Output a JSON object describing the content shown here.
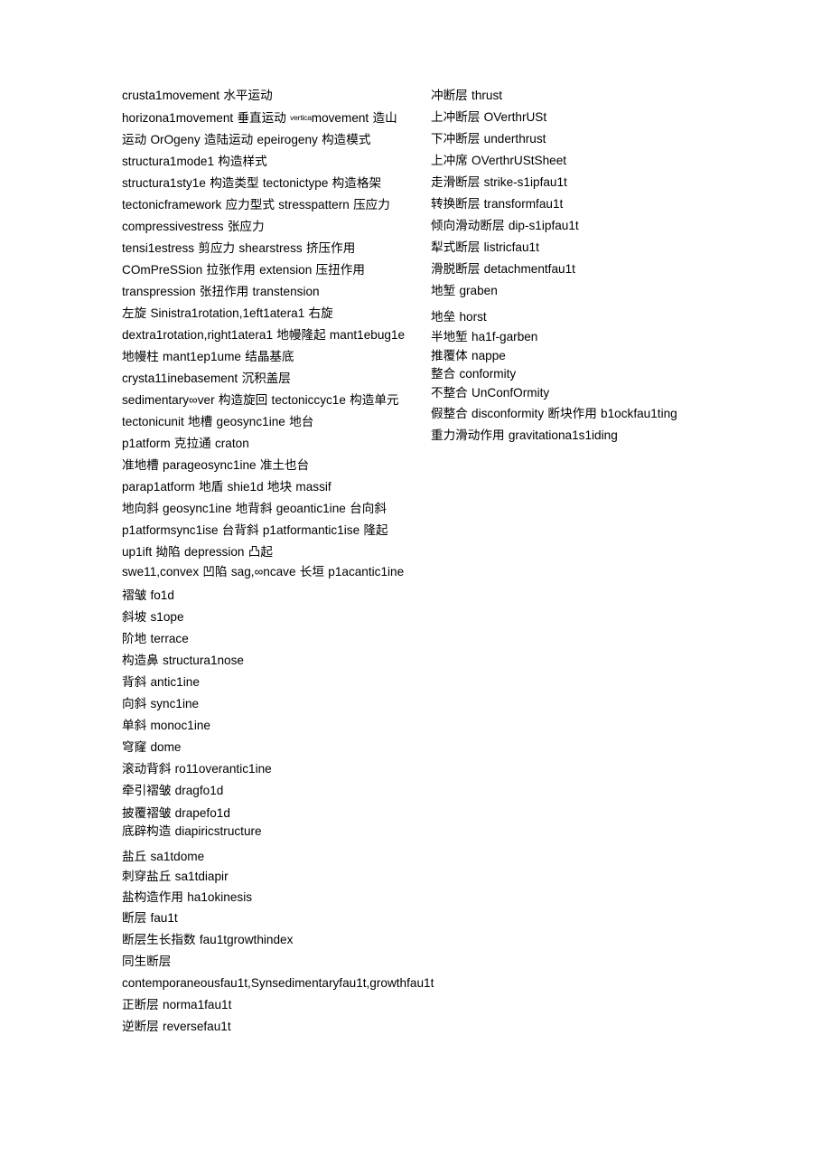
{
  "document": {
    "background_color": "#ffffff",
    "text_color": "#000000",
    "columns": {
      "left": {
        "blocks": [
          {
            "id": "b1",
            "text": "crusta1movement 水平运动"
          },
          {
            "id": "b2",
            "text_before": "horizona1movement 垂直运动 ",
            "superscript": "vertica",
            "text_after": "movement 造山运动 OrOgeny 造陆运动 epeirogeny 构造模式 structura1mode1 构造样式"
          },
          {
            "id": "b3",
            "text": "structura1sty1e 构造类型 tectonictype 构造格架 tectonicframework 应力型式 stresspattern 压应力 compressivestress 张应力"
          },
          {
            "id": "b4",
            "text": "tensi1estress 剪应力 shearstress 挤压作用 COmPreSSion 拉张作用 extension 压扭作用 transpression 张扭作用 transtension"
          },
          {
            "id": "b5",
            "text": "左旋 Sinistra1rotation,1eft1atera1 右旋 dextra1rotation,right1atera1 地幔隆起 mant1ebug1e 地幔柱 mant1ep1ume 结晶基底 crysta11inebasement 沉积盖层"
          },
          {
            "id": "b6",
            "text": "sedimentary∞ver 构造旋回 tectoniccyc1e 构造单元 tectonicunit 地槽 geosync1ine 地台"
          },
          {
            "id": "b7",
            "text": "p1atform 克拉通 craton"
          },
          {
            "id": "b8",
            "text": "准地槽 parageosync1ine 准土也台"
          },
          {
            "id": "b9",
            "text": "parap1atform 地盾 shie1d 地块 massif"
          },
          {
            "id": "b10",
            "text": "地向斜 geosync1ine 地背斜 geoantic1ine 台向斜 p1atformsync1ise 台背斜 p1atformantic1ise 隆起 up1ift 拗陷 depression 凸起"
          },
          {
            "id": "b11",
            "text": "swe11,convex 凹陷 sag,∞ncave 长垣 p1acantic1ine"
          },
          {
            "id": "b12",
            "text": "褶皱 fo1d"
          },
          {
            "id": "b13",
            "text": "斜坡 s1ope"
          },
          {
            "id": "b14",
            "text": "阶地 terrace"
          },
          {
            "id": "b15",
            "text": "构造鼻 structura1nose"
          },
          {
            "id": "b16",
            "text": "背斜 antic1ine"
          },
          {
            "id": "b17",
            "text": "向斜 sync1ine"
          },
          {
            "id": "b18",
            "text": "单斜 monoc1ine"
          },
          {
            "id": "b19",
            "text": "穹窿 dome"
          },
          {
            "id": "b20",
            "text": "滚动背斜 ro11overantic1ine"
          },
          {
            "id": "b21",
            "text": "牵引褶皱 dragfo1d"
          },
          {
            "id": "b22",
            "text": "披覆褶皱 drapefo1d"
          },
          {
            "id": "b23",
            "text": "底辟构造 diapiricstructure"
          },
          {
            "id": "b24",
            "text": "盐丘 sa1tdome"
          },
          {
            "id": "b25",
            "text": "刺穿盐丘 sa1tdiapir"
          },
          {
            "id": "b26",
            "text": "盐构造作用 ha1okinesis"
          },
          {
            "id": "b27",
            "text": "断层 fau1t"
          },
          {
            "id": "b28",
            "text": "断层生长指数 fau1tgrowthindex"
          },
          {
            "id": "b29",
            "text": "同生断层"
          },
          {
            "id": "b30",
            "text": "contemporaneousfau1t,Synsedimentaryfau1t,growthfau1t 正断层 norma1fau1t"
          },
          {
            "id": "b31",
            "text": "逆断层 reversefau1t"
          }
        ]
      },
      "right": {
        "blocks": [
          {
            "id": "r1",
            "text": "冲断层 thrust"
          },
          {
            "id": "r2",
            "text": "上冲断层 OVerthrUSt"
          },
          {
            "id": "r3",
            "text": "下冲断层 underthrust"
          },
          {
            "id": "r4",
            "text": "上冲席 OVerthrUStSheet"
          },
          {
            "id": "r5",
            "text": "走滑断层 strike-s1ipfau1t"
          },
          {
            "id": "r6",
            "text": "转换断层 transformfau1t"
          },
          {
            "id": "r7",
            "text": "倾向滑动断层 dip-s1ipfau1t"
          },
          {
            "id": "r8",
            "text": "犁式断层 listricfau1t"
          },
          {
            "id": "r9",
            "text": "滑脱断层 detachmentfau1t"
          },
          {
            "id": "r10",
            "text": "地堑 graben"
          },
          {
            "id": "r11",
            "text": "地垒 horst"
          },
          {
            "id": "r12",
            "text": "半地堑 ha1f-garben"
          },
          {
            "id": "r13",
            "text": "推覆体 nappe"
          },
          {
            "id": "r14",
            "text": "整合 conformity"
          },
          {
            "id": "r15",
            "text": "不整合 UnConfOrmity"
          },
          {
            "id": "r16",
            "text": "假整合 disconformity 断块作用 b1ockfau1ting"
          },
          {
            "id": "r17",
            "text": "重力滑动作用 gravitationa1s1iding"
          }
        ]
      }
    }
  }
}
